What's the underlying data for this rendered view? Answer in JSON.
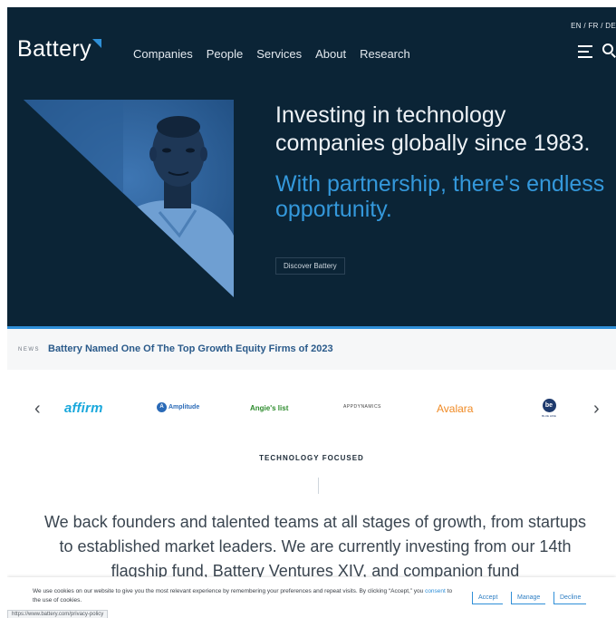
{
  "header": {
    "languages": "EN / FR / DE",
    "logo_text": "Battery",
    "nav": [
      "Companies",
      "People",
      "Services",
      "About",
      "Research"
    ],
    "icons": {
      "menu": "hamburger-menu-icon",
      "search": "search-icon"
    }
  },
  "hero": {
    "headline": "Investing in technology companies globally since 1983.",
    "subline": "With partnership, there's endless opportunity.",
    "cta_label": "Discover Battery"
  },
  "news": {
    "label": "NEWS",
    "title": "Battery Named One Of The Top Growth Equity Firms of 2023"
  },
  "carousel": {
    "logos": [
      "affirm",
      "Amplitude",
      "Angie's list",
      "APPDYNAMICS",
      "Avalara",
      "be"
    ],
    "amplitude_mark": "A",
    "brand_small_caption": "BLUE HIKE",
    "prev_icon": "chevron-left-icon",
    "next_icon": "chevron-right-icon"
  },
  "technology": {
    "eyebrow": "TECHNOLOGY FOCUSED",
    "mission": "We back founders and talented teams at all stages of growth, from startups to established market leaders. We are currently investing from our 14th flagship fund, Battery Ventures XIV, and companion fund"
  },
  "cookie": {
    "text_before": "We use cookies on our website to give you the most relevant experience by remembering your preferences and repeat visits. By clicking “Accept,” you ",
    "consent_link": "consent",
    "text_after": " to the use of cookies.",
    "accept": "Accept",
    "manage": "Manage",
    "decline": "Decline"
  },
  "status_url": "https://www.battery.com/privacy-policy",
  "colors": {
    "hero_bg": "#0b2436",
    "accent_blue": "#3498db",
    "news_title": "#2a5a8a"
  }
}
